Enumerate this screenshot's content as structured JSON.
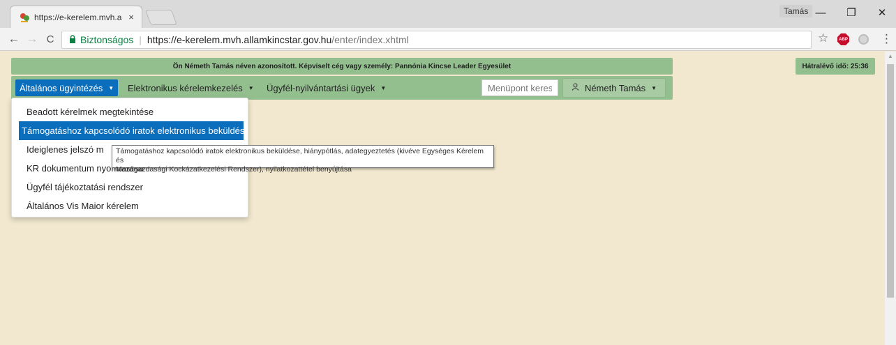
{
  "browser": {
    "tab_title": "https://e-kerelem.mvh.all",
    "tab_close": "×",
    "profile_name": "Tamás",
    "window_controls": {
      "minimize": "—",
      "maximize": "❐",
      "close": "✕"
    },
    "nav": {
      "back": "←",
      "forward": "→",
      "reload": "C"
    },
    "secure_label": "Biztonságos",
    "url_scheme": "https://",
    "url_host": "e-kerelem.mvh.allamkincstar.gov.hu",
    "url_path": "/enter/index.xhtml",
    "bookmark_star": "☆",
    "adblock_label": "ABP",
    "menu_icon": "⋮"
  },
  "header": {
    "identity_text": "Ön Németh Tamás néven azonosított.  Képviselt cég vagy személy: Pannónia Kincse Leader Egyesület",
    "timer_label": "Hátralévő idő: 25:36"
  },
  "menubar": {
    "items": [
      {
        "label": "Általános ügyintézés",
        "active": true
      },
      {
        "label": "Elektronikus kérelemkezelés",
        "active": false
      },
      {
        "label": "Ügyfél-nyilvántartási ügyek",
        "active": false
      }
    ],
    "search_placeholder": "Menüpont kereső",
    "user_label": "Németh Tamás"
  },
  "dropdown": {
    "items": [
      "Beadott kérelmek megtekintése",
      "Támogatáshoz kapcsolódó iratok elektronikus beküldése",
      "Ideiglenes jelszó m",
      "KR dokumentum nyomtatása",
      "Ügyfél tájékoztatási rendszer",
      "Általános Vis Maior kérelem"
    ],
    "hovered_index": 1
  },
  "tooltip": {
    "line1": "Támogatáshoz kapcsolódó iratok elektronikus beküldése, hiánypótlás, adategyeztetés (kivéve Egységes Kérelem és",
    "line2": "Mezőgazdasági Kockázatkezelési Rendszer), nyilatkozattétel benyújtása"
  },
  "colors": {
    "page_bg": "#f2e8cf",
    "header_green": "#93bf8f",
    "active_blue": "#0a6ebd",
    "secure_green": "#0b8043"
  }
}
